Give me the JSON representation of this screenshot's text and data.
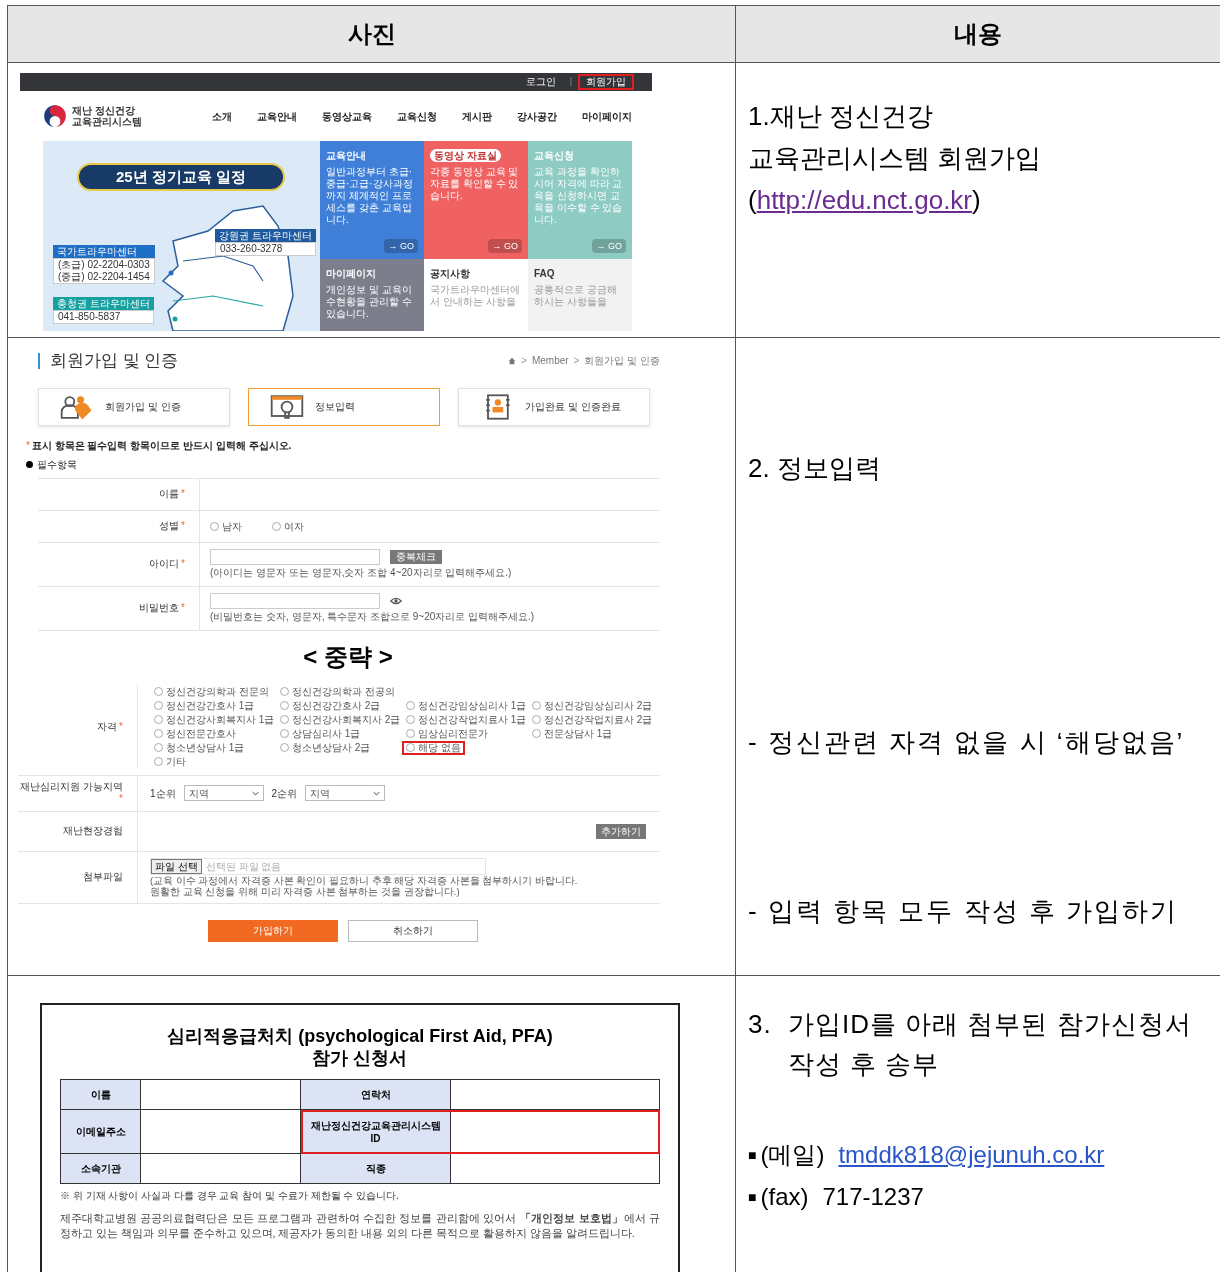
{
  "table": {
    "columns": [
      "사진",
      "내용"
    ],
    "rows": [
      {
        "kind": "homepage",
        "screenshot": {
          "top_links": [
            {
              "label": "로그인",
              "highlighted": false
            },
            {
              "label": "회원가입",
              "highlighted": true
            }
          ],
          "top_separator": "|",
          "logo": [
            "재난 정신건강",
            "교육관리시스템"
          ],
          "nav": [
            "소개",
            "교육안내",
            "동영상교육",
            "교육신청",
            "게시판",
            "강사공간",
            "마이페이지"
          ],
          "banner_title": "25년 정기교육 일정",
          "centers": [
            {
              "name": "강원권 트라우마센터",
              "phones": [
                "033-260-3278"
              ],
              "color": "#1f5a9e"
            },
            {
              "name": "국가트라우마센터",
              "phones": [
                "(초급) 02-2204-0303",
                "(중급) 02-2204-1454"
              ],
              "color": "#1f6fc6"
            },
            {
              "name": "충청권 트라우마센터",
              "phones": [
                "041-850-5837"
              ],
              "color": "#17a0a0"
            }
          ],
          "tiles": [
            {
              "title": "교육안내",
              "badge": false,
              "text": "일반과정부터 초급·중급·고급·강사과정까지 체계적인 프로세스를 갖춘 교육입니다.",
              "button": "→ GO",
              "color": "#3f7fd8"
            },
            {
              "title": "동영상 자료실",
              "badge": true,
              "text": "각종 동영상 교육 및 자료를 확인할 수 있습니다.",
              "button": "→ GO",
              "color": "#f06262"
            },
            {
              "title": "교육신청",
              "badge": false,
              "text": "교육 과정을 확인하시어 자격에 따라 교육을 신청하시면 교육을 이수할 수 있습니다.",
              "button": "→ GO",
              "color": "#8ecbc3"
            },
            {
              "title": "마이페이지",
              "badge": false,
              "text": "개인정보 및 교육이수현황을 관리할 수 있습니다.",
              "color": "#7c7e8c"
            },
            {
              "title": "공지사항",
              "badge": false,
              "text": "국가트라우마센터에서 안내하는 사항을",
              "color": "#ffffff"
            },
            {
              "title": "FAQ",
              "badge": false,
              "text": "공통적으로 궁금해하시는 사항들을",
              "color": "#f2f2f2"
            }
          ]
        },
        "description": {
          "lines": [
            "1.재난 정신건강",
            "교육관리시스템 회원가입"
          ],
          "link_open": "(",
          "link": "http://edu.nct.go.kr",
          "link_close": ")"
        }
      },
      {
        "kind": "signup_form",
        "screenshot": {
          "page_title": "회원가입 및 인증",
          "breadcrumb": {
            "separator": ">",
            "items": [
              "Member",
              "회원가입 및 인증"
            ]
          },
          "steps": [
            {
              "label": "회원가입 및 인증",
              "selected": false
            },
            {
              "label": "정보입력",
              "selected": true
            },
            {
              "label": "가입완료 및 인증완료",
              "selected": false
            }
          ],
          "required_mark": "*",
          "notice": "표시 항목은 필수입력 항목이므로 반드시 입력해 주십시오.",
          "section_title": "필수항목",
          "fields": [
            {
              "kind": "blank",
              "label": "이름",
              "required": true
            },
            {
              "kind": "radio",
              "label": "성별",
              "required": true,
              "options": [
                {
                  "label": "남자",
                  "checked": false
                },
                {
                  "label": "여자",
                  "checked": false
                }
              ]
            },
            {
              "kind": "id",
              "label": "아이디",
              "required": true,
              "button": "중복체크",
              "hint": "(아이디는 영문자 또는 영문자,숫자 조합 4~20자리로 입력해주세요.)"
            },
            {
              "kind": "password",
              "label": "비밀번호",
              "required": true,
              "hint": "(비밀번호는 숫자, 영문자, 특수문자 조합으로 9~20자리로 입력해주세요.)"
            }
          ],
          "omission": "< 중략 >",
          "more_fields": [
            {
              "kind": "radio_grid",
              "label": "자격",
              "required": true,
              "option_rows": [
                [
                  {
                    "label": "정신건강의학과 전문의",
                    "checked": false,
                    "highlighted": false
                  },
                  {
                    "label": "정신건강의학과 전공의",
                    "checked": false,
                    "highlighted": false
                  }
                ],
                [
                  {
                    "label": "정신건강간호사 1급",
                    "checked": false,
                    "highlighted": false
                  },
                  {
                    "label": "정신건강간호사 2급",
                    "checked": false,
                    "highlighted": false
                  },
                  {
                    "label": "정신건강임상심리사 1급",
                    "checked": false,
                    "highlighted": false
                  },
                  {
                    "label": "정신건강임상심리사 2급",
                    "checked": false,
                    "highlighted": false
                  }
                ],
                [
                  {
                    "label": "정신건강사회복지사 1급",
                    "checked": false,
                    "highlighted": false
                  },
                  {
                    "label": "정신건강사회복지사 2급",
                    "checked": false,
                    "highlighted": false
                  },
                  {
                    "label": "정신건강작업치료사 1급",
                    "checked": false,
                    "highlighted": false
                  },
                  {
                    "label": "정신건강작업치료사 2급",
                    "checked": false,
                    "highlighted": false
                  }
                ],
                [
                  {
                    "label": "정신전문간호사",
                    "checked": false,
                    "highlighted": false
                  },
                  {
                    "label": "상담심리사 1급",
                    "checked": false,
                    "highlighted": false
                  },
                  {
                    "label": "임상심리전문가",
                    "checked": false,
                    "highlighted": false
                  },
                  {
                    "label": "전문상담사 1급",
                    "checked": false,
                    "highlighted": false
                  }
                ],
                [
                  {
                    "label": "청소년상담사 1급",
                    "checked": false,
                    "highlighted": false
                  },
                  {
                    "label": "청소년상담사 2급",
                    "checked": false,
                    "highlighted": false
                  },
                  {
                    "label": "해당 없음",
                    "checked": false,
                    "highlighted": true
                  }
                ],
                [
                  {
                    "label": "기타",
                    "checked": false,
                    "highlighted": false
                  }
                ]
              ]
            },
            {
              "kind": "selects",
              "label": "재난심리지원 가능지역",
              "required": true,
              "selects": [
                {
                  "prefix": "1순위",
                  "value": "지역"
                },
                {
                  "prefix": "2순위",
                  "value": "지역"
                }
              ]
            },
            {
              "kind": "add",
              "label": "재난현장경험",
              "required": false,
              "button": "추가하기"
            },
            {
              "kind": "file",
              "label": "첨부파일",
              "required": false,
              "button": "파일 선택",
              "status": "선택된 파일 없음",
              "hint": [
                "(교육 이수 과정에서 자격증 사본 확인이 필요하니 추후 해당 자격증 사본을 첨부하시기 바랍니다.",
                "원활한 교육 신청을 위해 미리 자격증 사본 첨부하는 것을 권장합니다.)"
              ]
            }
          ],
          "actions": [
            {
              "label": "가입하기",
              "kind": "primary"
            },
            {
              "label": "취소하기",
              "kind": "secondary"
            }
          ]
        },
        "description": [
          {
            "kind": "heading",
            "text": "2. 정보입력"
          },
          {
            "kind": "note",
            "text": "- 정신관련 자격 없을 시 ‘해당없음’"
          },
          {
            "kind": "note",
            "text": "- 입력 항목 모두 작성 후 가입하기"
          }
        ]
      },
      {
        "kind": "application_form",
        "screenshot": {
          "title": "심리적응급처치 (psychological First Aid, PFA)",
          "subtitle": "참가 신청서",
          "fields": [
            {
              "label": "이름",
              "highlighted": false
            },
            {
              "label": "연락처",
              "highlighted": false
            },
            {
              "label": "이메일주소",
              "highlighted": false
            },
            {
              "label": "재난정신건강교육관리시스템 ID",
              "highlighted": true
            },
            {
              "label": "소속기관",
              "highlighted": false
            },
            {
              "label": "직종",
              "highlighted": false
            }
          ],
          "note": "※ 위 기재 사항이 사실과 다를 경우 교육 참여 및 수료가 제한될 수 있습니다.",
          "privacy": "제주대학교병원 공공의료협력단은 모든 프로그램과 관련하여 수집한 정보를 관리함에 있어서 **「개인정보 보호법」**에서 규정하고 있는 책임과 의무를 준수하고 있으며, 제공자가 동의한 내용 외의 다른 목적으로 활용하지 않음을 알려드립니다."
        },
        "description": {
          "number": "3.",
          "text": "가입ID를 아래 첨부된 참가신청서 작성 후 송부",
          "contacts": [
            {
              "bullet": "■",
              "label": "(메일)",
              "value": "tmddk818@jejunuh.co.kr",
              "kind": "link"
            },
            {
              "bullet": "■",
              "label": "(fax)",
              "value": "717-1237",
              "kind": "text"
            }
          ]
        }
      }
    ]
  }
}
